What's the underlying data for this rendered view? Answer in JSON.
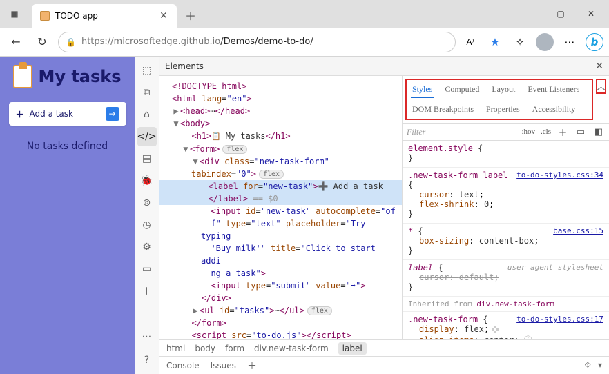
{
  "tab": {
    "title": "TODO app"
  },
  "url": {
    "host": "https://microsoftedge.github.io",
    "path": "/Demos/demo-to-do/"
  },
  "page": {
    "h1": "My tasks",
    "add_label": "Add a task",
    "empty": "No tasks defined"
  },
  "devtools": {
    "panel_title": "Elements",
    "crumbs": [
      "html",
      "body",
      "form",
      "div.new-task-form",
      "label"
    ],
    "drawer_tabs": [
      "Console",
      "Issues"
    ],
    "side_tabs": [
      "Styles",
      "Computed",
      "Layout",
      "Event Listeners",
      "DOM Breakpoints",
      "Properties",
      "Accessibility"
    ],
    "filter_placeholder": "Filter",
    "hov": ":hov",
    "cls": ".cls",
    "dom": {
      "doctype": "<!DOCTYPE html>",
      "html_open": "html",
      "html_lang": "en",
      "head": "head",
      "body": "body",
      "h1_text": "My tasks",
      "form": "form",
      "div_class": "new-task-form",
      "div_tabindex": "0",
      "label_for": "new-task",
      "label_text": "Add a task",
      "eq0": "== $0",
      "input_id": "new-task",
      "input_autocomplete": "off",
      "input_type": "text",
      "input_placeholder": "Try typing 'Buy milk'",
      "input_title": "Click to start adding a task",
      "submit_type": "submit",
      "submit_value": "➡",
      "ul_id": "tasks",
      "script_src": "to-do.js",
      "flex_badge": "flex"
    },
    "rules": {
      "r0_sel": "element.style",
      "r1_sel": ".new-task-form label",
      "r1_src": "to-do-styles.css:34",
      "r1_p1n": "cursor",
      "r1_p1v": "text",
      "r1_p2n": "flex-shrink",
      "r1_p2v": "0",
      "r2_sel": "*",
      "r2_src": "base.css:15",
      "r2_p1n": "box-sizing",
      "r2_p1v": "content-box",
      "r3_sel": "label",
      "r3_ua": "user agent stylesheet",
      "r3_p1n": "cursor",
      "r3_p1v": "default",
      "inherit_label": "Inherited from",
      "inherit_from": "div.new-task-form",
      "r4_sel": ".new-task-form",
      "r4_src": "to-do-styles.css:17",
      "r4_p1n": "display",
      "r4_p1v": "flex",
      "r4_p2n": "align-items",
      "r4_p2v": "center"
    }
  }
}
